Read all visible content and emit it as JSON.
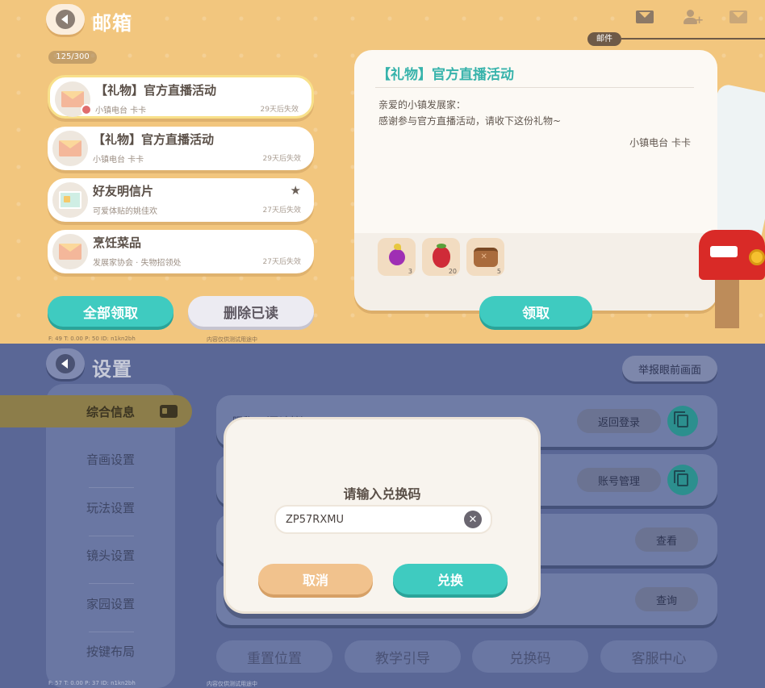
{
  "mailbox": {
    "title": "邮箱",
    "tab_label": "邮件",
    "count": "125/300",
    "items": [
      {
        "title": "【礼物】官方直播活动",
        "from": "小镇电台 卡卡",
        "expiry": "29天后失效"
      },
      {
        "title": "【礼物】官方直播活动",
        "from": "小镇电台 卡卡",
        "expiry": "29天后失效"
      },
      {
        "title": "好友明信片",
        "from": "可爱体贴的姚佳欢",
        "expiry": "27天后失效"
      },
      {
        "title": "烹饪菜品",
        "from": "发展家协会 · 失物招领处",
        "expiry": "27天后失效"
      }
    ],
    "collect_all_label": "全部领取",
    "delete_read_label": "删除已读",
    "detail": {
      "title": "【礼物】官方直播活动",
      "greeting": "亲爱的小镇发展家：",
      "body": "感谢参与官方直播活动，请收下这份礼物~",
      "signature": "小镇电台 卡卡",
      "rewards": [
        {
          "icon": "purple-fruit-icon",
          "count": "3"
        },
        {
          "icon": "raspberry-icon",
          "count": "20"
        },
        {
          "icon": "leather-bag-icon",
          "count": "5"
        }
      ],
      "claim_label": "领取"
    },
    "debug": {
      "left": "F: 49   T: 0.00   P: 50   ID: n1kn2bh",
      "center": "内容仅供测试用途中"
    },
    "colors": {
      "bg": "#f2c67e",
      "accent": "#3fcbc0",
      "title_accent": "#37b3ab"
    }
  },
  "settings": {
    "title": "设置",
    "report_label": "举报眼前画面",
    "nav": [
      "综合信息",
      "音画设置",
      "玩法设置",
      "镜头设置",
      "家园设置",
      "按键布局"
    ],
    "row_buttons": [
      "返回登录",
      "账号管理",
      "查看",
      "查询"
    ],
    "row_peek": "昵称：（已遮挡）",
    "bottom_buttons": [
      "重置位置",
      "教学引导",
      "兑换码",
      "客服中心"
    ],
    "modal": {
      "heading": "请输入兑换码",
      "code_value": "ZP57RXMU",
      "cancel_label": "取消",
      "redeem_label": "兑换"
    },
    "debug": {
      "left": "F: 57   T: 0.00   P: 37   ID: n1kn2bh",
      "center": "内容仅供测试用途中"
    },
    "colors": {
      "bg": "#5a6796",
      "nav_active": "#8c7d4a",
      "copy_button": "#2c8f8e"
    }
  }
}
